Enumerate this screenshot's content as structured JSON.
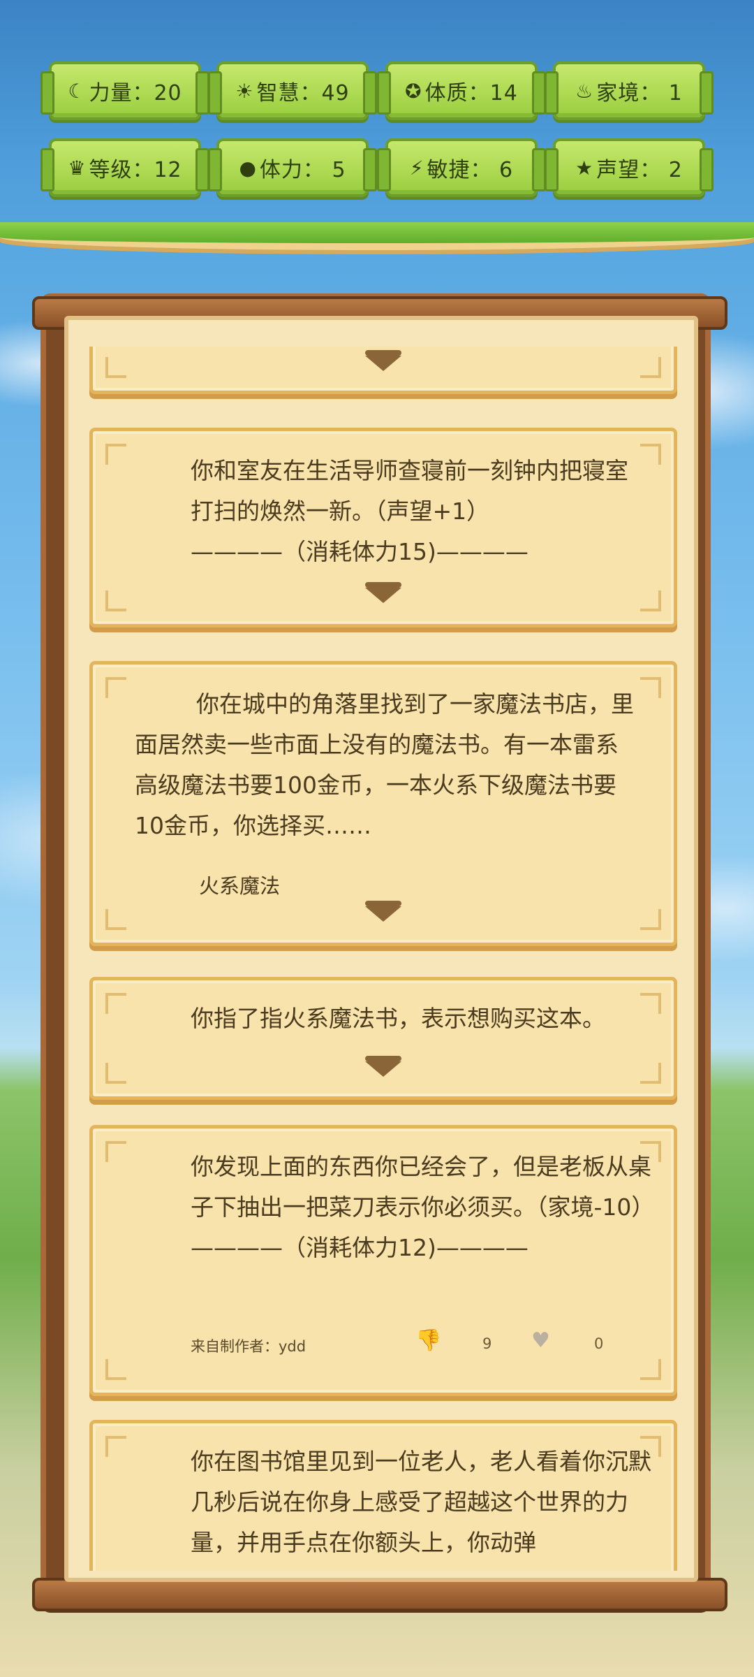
{
  "stats": [
    {
      "icon": "strength-icon",
      "glyph": "☾",
      "label": "力量：20"
    },
    {
      "icon": "wisdom-icon",
      "glyph": "☀",
      "label": "智慧：49"
    },
    {
      "icon": "constitution-icon",
      "glyph": "✪",
      "label": "体质：14"
    },
    {
      "icon": "family-icon",
      "glyph": "♨",
      "label": "家境：  1"
    },
    {
      "icon": "level-icon",
      "glyph": "♛",
      "label": "等级：12"
    },
    {
      "icon": "stamina-icon",
      "glyph": "●",
      "label": "体力：  5"
    },
    {
      "icon": "agility-icon",
      "glyph": "⚡",
      "label": "敏捷：  6"
    },
    {
      "icon": "reputation-icon",
      "glyph": "★",
      "label": "声望：  2"
    }
  ],
  "events": [
    {
      "text": ""
    },
    {
      "text": "你和室友在生活导师查寝前一刻钟内把寝室打扫的焕然一新。（声望+1）\n————（消耗体力15)————"
    },
    {
      "text": "你在城中的角落里找到了一家魔法书店，里面居然卖一些市面上没有的魔法书。有一本雷系高级魔法书要100金币，一本火系下级魔法书要10金币，你选择买……",
      "choice": "火系魔法"
    },
    {
      "text": "你指了指火系魔法书，表示想购买这本。"
    },
    {
      "text": "你发现上面的东西你已经会了，但是老板从桌子下抽出一把菜刀表示你必须买。（家境-10）\n————（消耗体力12)————",
      "author": "来自制作者：ydd",
      "dislikes": "9",
      "likes": "0"
    },
    {
      "text": "你在图书馆里见到一位老人，老人看着你沉默几秒后说在你身上感受了超越这个世界的力量，并用手点在你额头上，你动弹"
    }
  ],
  "colors": {
    "stat_bg": "#a9d64d",
    "card_bg": "#f8e3ac",
    "frame": "#7a4a24",
    "dislike": "#e0303a"
  }
}
